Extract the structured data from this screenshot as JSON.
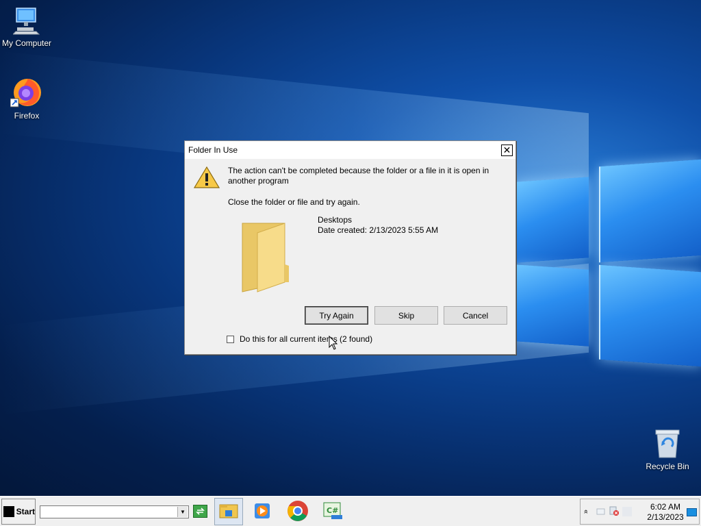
{
  "desktop": {
    "icons": [
      {
        "label": "My Computer",
        "icon": "computer-icon"
      },
      {
        "label": "Firefox",
        "icon": "firefox-icon"
      },
      {
        "label": "Recycle Bin",
        "icon": "recycle-bin-icon"
      }
    ]
  },
  "dialog": {
    "title": "Folder In Use",
    "close_label": "✕",
    "message": "The action can't be completed because the folder or a file in it is open in another program",
    "instruction": "Close the folder or file and try again.",
    "item_name": "Desktops",
    "item_date": "Date created: 2/13/2023 5:55 AM",
    "buttons": {
      "try_again": "Try Again",
      "skip": "Skip",
      "cancel": "Cancel"
    },
    "checkbox_label": "Do this for all current items (2 found)",
    "checkbox_checked": false
  },
  "taskbar": {
    "start_label": "Start",
    "address_value": "",
    "apps": [
      "file-explorer-icon",
      "media-player-icon",
      "chrome-icon",
      "csharp-icon"
    ],
    "tray_expand": "»",
    "clock": {
      "time": "6:02 AM",
      "date": "2/13/2023"
    }
  },
  "colors": {
    "wallpaper": "#0f4fa8",
    "dialog_bg": "#f0f0f0",
    "taskbar_bg": "#f0f0f0"
  }
}
